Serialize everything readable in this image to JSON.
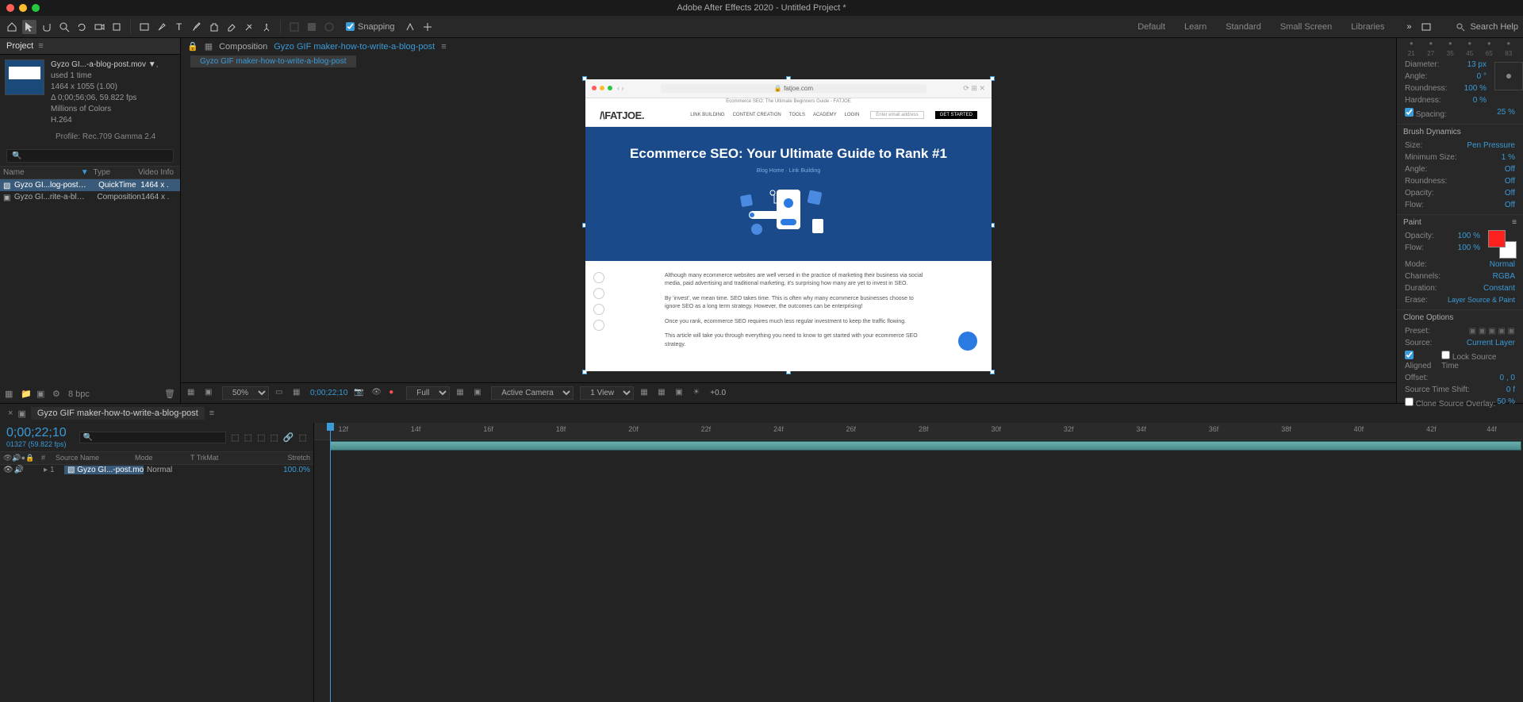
{
  "app": {
    "title": "Adobe After Effects 2020 - Untitled Project *"
  },
  "toolbar": {
    "snapping": "Snapping"
  },
  "workspaces": {
    "items": [
      "Default",
      "Learn",
      "Standard",
      "Small Screen",
      "Libraries"
    ],
    "search": "Search Help"
  },
  "project": {
    "tab": "Project",
    "asset": {
      "name": "Gyzo GI...-a-blog-post.mov ▼",
      "used": ", used 1 time",
      "dims": "1464 x 1055 (1.00)",
      "duration": "Δ 0;00;56;06, 59.822 fps",
      "colors": "Millions of Colors",
      "codec": "H.264",
      "profile": "Profile: Rec.709 Gamma 2.4"
    },
    "headers": {
      "name": "Name",
      "type": "Type",
      "vinfo": "Video Info"
    },
    "rows": [
      {
        "name": "Gyzo GI...log-post.mov",
        "type": "QuickTime",
        "vinfo": "1464 x ."
      },
      {
        "name": "Gyzo GI...rite-a-blog-post",
        "type": "Composition",
        "vinfo": "1464 x ."
      }
    ],
    "bpc": "8 bpc"
  },
  "composition": {
    "tabLabel": "Composition",
    "name": "Gyzo GIF maker-how-to-write-a-blog-post",
    "crumb": "Gyzo GIF maker-how-to-write-a-blog-post"
  },
  "page": {
    "url": "fatjoe.com",
    "tabtitle": "Ecommerce SEO: The Ultimate Beginners Guide - FATJOE",
    "logo": "/\\FATJOE.",
    "nav": [
      "LINK BUILDING",
      "CONTENT CREATION",
      "TOOLS",
      "ACADEMY",
      "LOGIN"
    ],
    "emailPlaceholder": "Enter email address",
    "cta": "GET STARTED",
    "heroTitle": "Ecommerce SEO: Your Ultimate Guide to Rank #1",
    "heroLinks": "Blog Home · Link Building",
    "p1": "Although many ecommerce websites are well versed in the practice of marketing their business via social media, paid advertising and traditional marketing, it's surprising how many are yet to invest in SEO.",
    "p2": "By 'invest', we mean time. SEO takes time. This is often why many ecommerce businesses choose to ignore SEO as a long term strategy. However, the outcomes can be enterprising!",
    "p3": "Once you rank, ecommerce SEO requires much less regular investment to keep the traffic flowing.",
    "p4": "This article will take you through everything you need to know to get started with your ecommerce SEO strategy."
  },
  "viewerFooter": {
    "zoom": "50%",
    "time": "0;00;22;10",
    "res": "Full",
    "camera": "Active Camera",
    "views": "1 View",
    "exposure": "+0.0"
  },
  "brush": {
    "ticks": [
      "21",
      "27",
      "35",
      "45",
      "65",
      "83"
    ],
    "diameter": {
      "label": "Diameter:",
      "val": "13 px"
    },
    "angle": {
      "label": "Angle:",
      "val": "0 °"
    },
    "roundness": {
      "label": "Roundness:",
      "val": "100 %"
    },
    "hardness": {
      "label": "Hardness:",
      "val": "0 %"
    },
    "spacing": {
      "label": "Spacing:",
      "val": "25 %"
    },
    "dynamics": "Brush Dynamics",
    "size": {
      "label": "Size:",
      "val": "Pen Pressure"
    },
    "minsize": {
      "label": "Minimum Size:",
      "val": "1 %"
    },
    "angle2": {
      "label": "Angle:",
      "val": "Off"
    },
    "roundness2": {
      "label": "Roundness:",
      "val": "Off"
    },
    "opacity": {
      "label": "Opacity:",
      "val": "Off"
    },
    "flow": {
      "label": "Flow:",
      "val": "Off"
    }
  },
  "paint": {
    "title": "Paint",
    "opacity": {
      "label": "Opacity:",
      "val": "100 %"
    },
    "flow": {
      "label": "Flow:",
      "val": "100 %"
    },
    "mode": {
      "label": "Mode:",
      "val": "Normal"
    },
    "channels": {
      "label": "Channels:",
      "val": "RGBA"
    },
    "duration": {
      "label": "Duration:",
      "val": "Constant"
    },
    "erase": {
      "label": "Erase:",
      "val": "Layer Source & Paint"
    },
    "cloneOptions": "Clone Options",
    "preset": {
      "label": "Preset:"
    },
    "source": {
      "label": "Source:",
      "val": "Current Layer"
    },
    "aligned": "Aligned",
    "lockSource": "Lock Source Time",
    "offset": {
      "label": "Offset:",
      "val": "0 , 0"
    },
    "timeShift": {
      "label": "Source Time Shift:",
      "val": "0 f"
    },
    "overlay": {
      "label": "Clone Source Overlay:",
      "val": "50 %"
    }
  },
  "timeline": {
    "tabName": "Gyzo GIF maker-how-to-write-a-blog-post",
    "timecode": "0;00;22;10",
    "timesub": "01327 (59.822 fps)",
    "headers": {
      "src": "Source Name",
      "mode": "Mode",
      "trk": "TrkMat",
      "stretch": "Stretch"
    },
    "layer": {
      "idx": "1",
      "name": "Gyzo GI...-post.mov",
      "mode": "Normal",
      "stretch": "100.0%"
    },
    "ticks": [
      "12f",
      "14f",
      "16f",
      "18f",
      "20f",
      "22f",
      "24f",
      "26f",
      "28f",
      "30f",
      "32f",
      "34f",
      "36f",
      "38f",
      "40f",
      "42f",
      "44f"
    ]
  }
}
